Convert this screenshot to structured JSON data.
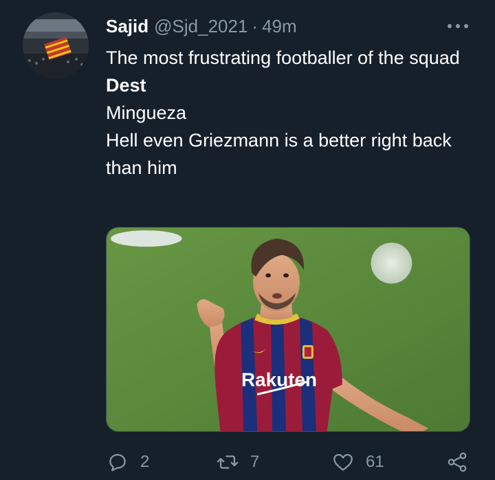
{
  "tweet": {
    "author_name": "Sajid",
    "handle": "@Sjd_2021",
    "separator": "·",
    "time": "49m",
    "lines": [
      "The most frustrating footballer of the squad",
      "Dest",
      "Mingueza",
      "Hell even Griezmann is a better right back than him"
    ],
    "image": {
      "icon": "player-photo",
      "shirt_sponsor": "Rakuten"
    }
  },
  "actions": {
    "reply_count": "2",
    "retweet_count": "7",
    "like_count": "61"
  },
  "icons": {
    "more": "more-options-icon",
    "reply": "reply-icon",
    "retweet": "retweet-icon",
    "like": "heart-icon",
    "share": "share-icon"
  },
  "colors": {
    "background": "#15202b",
    "text": "#ffffff",
    "secondary": "#8899a6",
    "media_border": "#3d4b58"
  }
}
